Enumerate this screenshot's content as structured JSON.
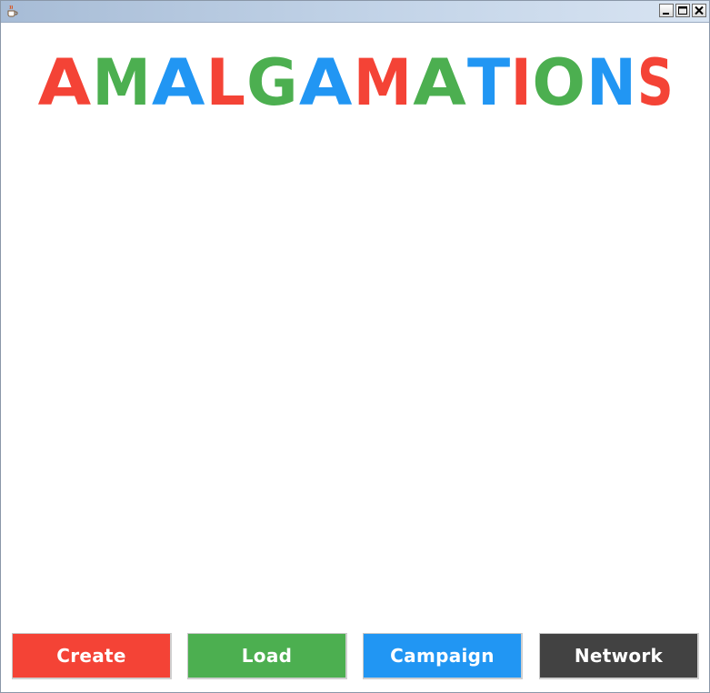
{
  "window": {
    "icon": "java-cup-icon",
    "controls": {
      "minimize": "minimize-icon",
      "maximize": "maximize-icon",
      "close": "close-icon"
    }
  },
  "logo": {
    "text": "AMALGAMATIONS",
    "letters": [
      {
        "char": "A",
        "color": "#f44336"
      },
      {
        "char": "M",
        "color": "#4caf50"
      },
      {
        "char": "A",
        "color": "#2196f3"
      },
      {
        "char": "L",
        "color": "#f44336"
      },
      {
        "char": "G",
        "color": "#4caf50"
      },
      {
        "char": "A",
        "color": "#2196f3"
      },
      {
        "char": "M",
        "color": "#f44336"
      },
      {
        "char": "A",
        "color": "#4caf50"
      },
      {
        "char": "T",
        "color": "#2196f3"
      },
      {
        "char": "I",
        "color": "#f44336"
      },
      {
        "char": "O",
        "color": "#4caf50"
      },
      {
        "char": "N",
        "color": "#2196f3"
      },
      {
        "char": "S",
        "color": "#f44336"
      }
    ]
  },
  "buttons": [
    {
      "id": "create",
      "label": "Create",
      "color": "#f44336"
    },
    {
      "id": "load",
      "label": "Load",
      "color": "#4caf50"
    },
    {
      "id": "campaign",
      "label": "Campaign",
      "color": "#2196f3"
    },
    {
      "id": "network",
      "label": "Network",
      "color": "#424242"
    }
  ]
}
